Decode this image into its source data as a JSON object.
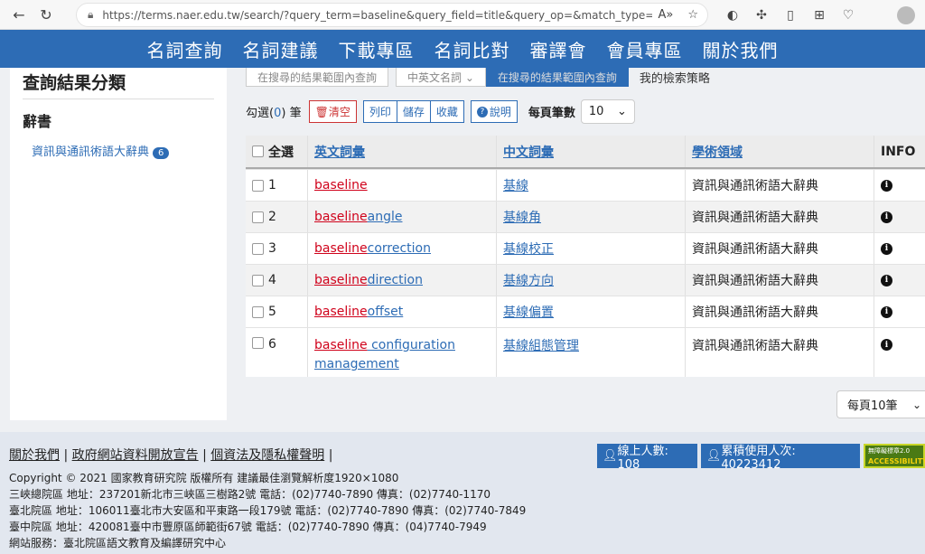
{
  "browser": {
    "url": "https://terms.naer.edu.tw/search/?query_term=baseline&query_field=title&query_op=&match_type=phrase..."
  },
  "nav": [
    "名詞查詢",
    "名詞建議",
    "下載專區",
    "名詞比對",
    "審譯會",
    "會員專區",
    "關於我們"
  ],
  "sidebar": {
    "title": "查詢結果分類",
    "section": "辭書",
    "item_label": "資訊與通訊術語大辭典",
    "item_count": "6"
  },
  "tabs": [
    "在搜尋的結果範圍內查詢",
    "中英文名詞 ⌄",
    "在搜尋的結果範圍內查詢",
    "我的檢索策略"
  ],
  "toolbar": {
    "selected_prefix": "勾選(",
    "selected_count": "0",
    "selected_suffix": ") 筆",
    "clear": "清空",
    "list": "列印",
    "save": "儲存",
    "collect": "收藏",
    "help": "說明",
    "per_page_label": "每頁筆數",
    "per_page_value": "10"
  },
  "table": {
    "headers": [
      "全選",
      "英文詞彙",
      "中文詞彙",
      "學術領域",
      "INFO"
    ],
    "rows": [
      {
        "n": "1",
        "kw": "baseline",
        "rest": "",
        "zh": "基線",
        "field": "資訊與通訊術語大辭典"
      },
      {
        "n": "2",
        "kw": "baseline",
        "rest": " angle",
        "zh": "基線角",
        "field": "資訊與通訊術語大辭典"
      },
      {
        "n": "3",
        "kw": "baseline",
        "rest": " correction",
        "zh": "基線校正",
        "field": "資訊與通訊術語大辭典"
      },
      {
        "n": "4",
        "kw": "baseline",
        "rest": " direction",
        "zh": "基線方向",
        "field": "資訊與通訊術語大辭典"
      },
      {
        "n": "5",
        "kw": "baseline",
        "rest": " offset",
        "zh": "基線偏置",
        "field": "資訊與通訊術語大辭典"
      },
      {
        "n": "6",
        "kw": "baseline",
        "rest": " configuration management",
        "zh": "基線組態管理",
        "field": "資訊與通訊術語大辭典"
      }
    ]
  },
  "per_page_bottom": "每頁10筆",
  "footer": {
    "links": [
      "關於我們",
      "政府網站資料開放宣告",
      "個資法及隱私權聲明"
    ],
    "online": "線上人數: 108",
    "visits": "累積使用人次: 40223412",
    "access_line1": "無障礙標章2.0",
    "access_line2": "ACCESSIBILITY",
    "lines": [
      "Copyright © 2021 國家教育研究院 版權所有 建議最佳瀏覽解析度1920×1080",
      "三峽總院區 地址：237201新北市三峽區三樹路2號 電話：(02)7740-7890 傳真：(02)7740-1170",
      "臺北院區 地址：106011臺北市大安區和平東路一段179號 電話：(02)7740-7890 傳真：(02)7740-7849",
      "臺中院區 地址：420081臺中市豐原區師範街67號 電話：(02)7740-7890 傳真：(04)7740-7949",
      "網站服務：臺北院區語文教育及編譯研究中心"
    ]
  }
}
